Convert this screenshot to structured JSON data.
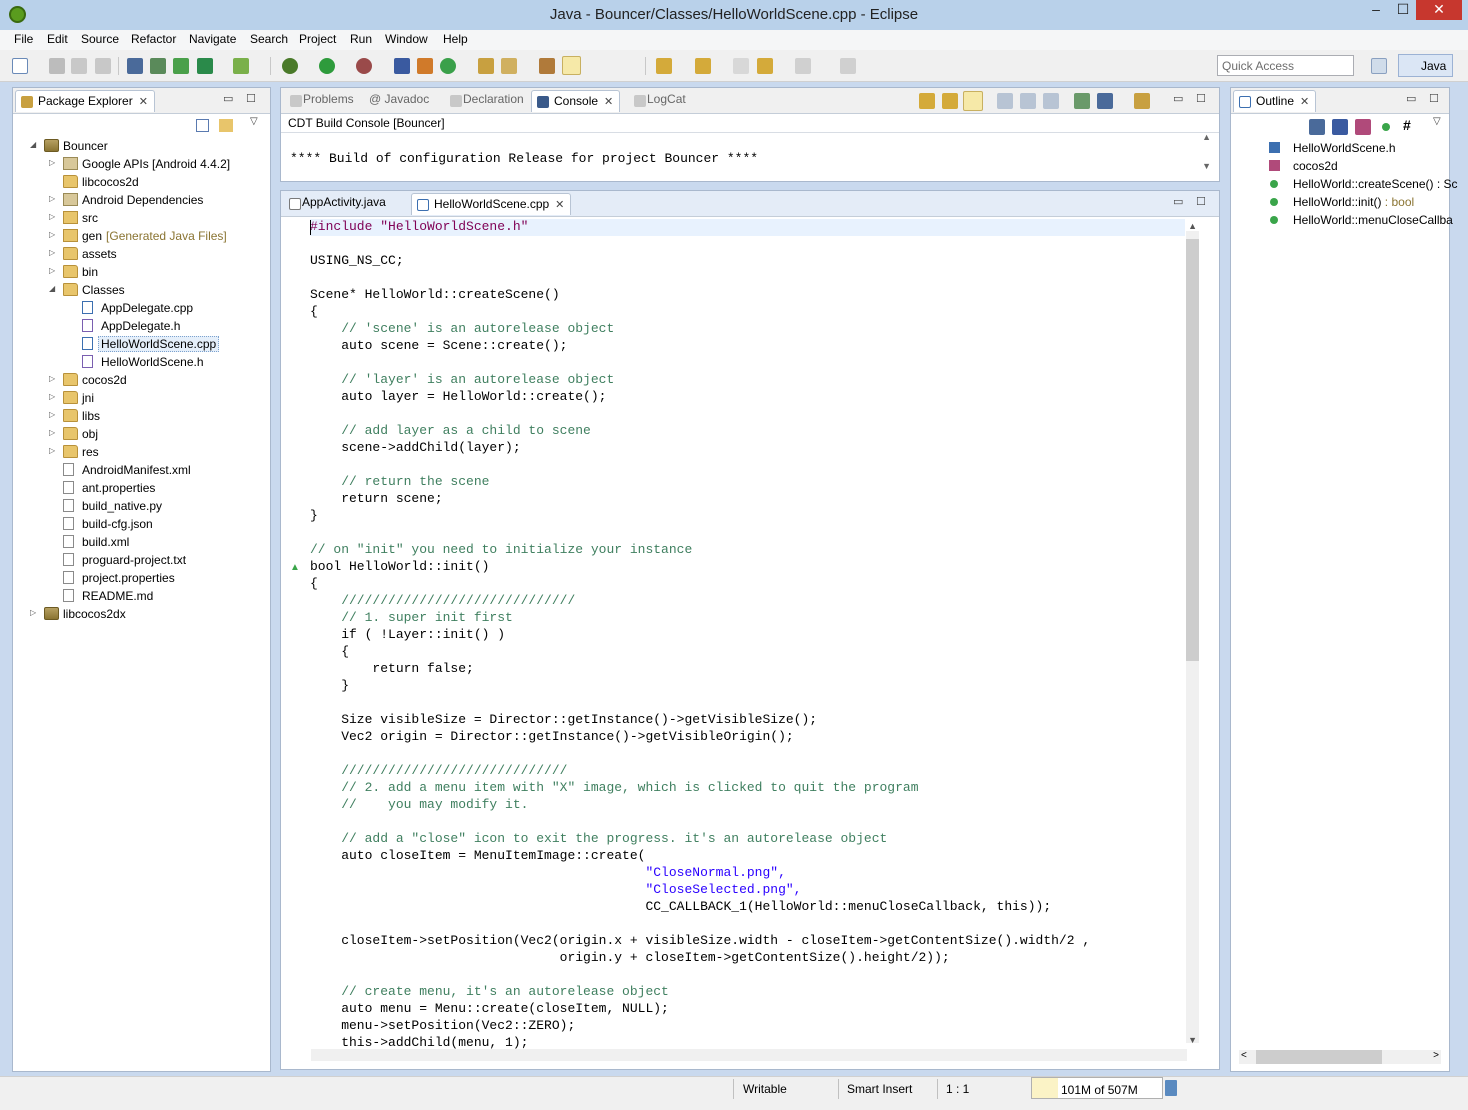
{
  "window": {
    "title": "Java - Bouncer/Classes/HelloWorldScene.cpp - Eclipse",
    "minimize": "–",
    "maximize": "☐",
    "close": "✕"
  },
  "menu": [
    "File",
    "Edit",
    "Source",
    "Refactor",
    "Navigate",
    "Search",
    "Project",
    "Run",
    "Window",
    "Help"
  ],
  "toolbar": {
    "quick_access_placeholder": "Quick Access",
    "perspective": "Java"
  },
  "package_explorer": {
    "tab": "Package Explorer",
    "items": [
      {
        "label": "Bouncer",
        "indent": 0,
        "icon": "project-icon",
        "expanded": true
      },
      {
        "label": "Google APIs [Android 4.4.2]",
        "indent": 1,
        "icon": "library-icon"
      },
      {
        "label": "libcocos2d",
        "indent": 1,
        "icon": "folder-icon",
        "leaf": true
      },
      {
        "label": "Android Dependencies",
        "indent": 1,
        "icon": "library-icon"
      },
      {
        "label": "src",
        "indent": 1,
        "icon": "source-folder-icon"
      },
      {
        "label": "gen",
        "suffix": "[Generated Java Files]",
        "indent": 1,
        "icon": "source-folder-icon"
      },
      {
        "label": "assets",
        "indent": 1,
        "icon": "folder-icon"
      },
      {
        "label": "bin",
        "indent": 1,
        "icon": "folder-icon"
      },
      {
        "label": "Classes",
        "indent": 1,
        "icon": "folder-icon",
        "expanded": true
      },
      {
        "label": "AppDelegate.cpp",
        "indent": 2,
        "icon": "cpp-file-icon",
        "leaf": true
      },
      {
        "label": "AppDelegate.h",
        "indent": 2,
        "icon": "header-file-icon",
        "leaf": true
      },
      {
        "label": "HelloWorldScene.cpp",
        "indent": 2,
        "icon": "cpp-file-icon",
        "leaf": true,
        "selected": true
      },
      {
        "label": "HelloWorldScene.h",
        "indent": 2,
        "icon": "header-file-icon",
        "leaf": true
      },
      {
        "label": "cocos2d",
        "indent": 1,
        "icon": "folder-icon"
      },
      {
        "label": "jni",
        "indent": 1,
        "icon": "folder-icon"
      },
      {
        "label": "libs",
        "indent": 1,
        "icon": "folder-icon"
      },
      {
        "label": "obj",
        "indent": 1,
        "icon": "folder-icon"
      },
      {
        "label": "res",
        "indent": 1,
        "icon": "folder-icon"
      },
      {
        "label": "AndroidManifest.xml",
        "indent": 1,
        "icon": "file-icon",
        "leaf": true
      },
      {
        "label": "ant.properties",
        "indent": 1,
        "icon": "file-icon",
        "leaf": true
      },
      {
        "label": "build_native.py",
        "indent": 1,
        "icon": "file-icon",
        "leaf": true
      },
      {
        "label": "build-cfg.json",
        "indent": 1,
        "icon": "file-icon",
        "leaf": true
      },
      {
        "label": "build.xml",
        "indent": 1,
        "icon": "file-icon",
        "leaf": true
      },
      {
        "label": "proguard-project.txt",
        "indent": 1,
        "icon": "file-icon",
        "leaf": true
      },
      {
        "label": "project.properties",
        "indent": 1,
        "icon": "file-icon",
        "leaf": true
      },
      {
        "label": "README.md",
        "indent": 1,
        "icon": "file-icon",
        "leaf": true
      },
      {
        "label": "libcocos2dx",
        "indent": 0,
        "icon": "project-icon"
      }
    ]
  },
  "console_panel": {
    "tabs": [
      {
        "label": "Problems"
      },
      {
        "label": "@ Javadoc"
      },
      {
        "label": "Declaration"
      },
      {
        "label": "Console",
        "active": true
      },
      {
        "label": "LogCat"
      }
    ],
    "header": "CDT Build Console [Bouncer]",
    "text": "**** Build of configuration Release for project Bouncer ****"
  },
  "editor": {
    "tabs": [
      {
        "label": "AppActivity.java"
      },
      {
        "label": "HelloWorldScene.cpp",
        "active": true
      }
    ],
    "lines": [
      {
        "text": "#include \"HelloWorldScene.h\"",
        "kind": "pp"
      },
      {
        "text": ""
      },
      {
        "text": "USING_NS_CC;"
      },
      {
        "text": ""
      },
      {
        "text": "Scene* HelloWorld::createScene()"
      },
      {
        "text": "{"
      },
      {
        "text": "    // 'scene' is an autorelease object",
        "kind": "cm"
      },
      {
        "text": "    auto scene = Scene::create();"
      },
      {
        "text": ""
      },
      {
        "text": "    // 'layer' is an autorelease object",
        "kind": "cm"
      },
      {
        "text": "    auto layer = HelloWorld::create();"
      },
      {
        "text": ""
      },
      {
        "text": "    // add layer as a child to scene",
        "kind": "cm"
      },
      {
        "text": "    scene->addChild(layer);"
      },
      {
        "text": ""
      },
      {
        "text": "    // return the scene",
        "kind": "cm"
      },
      {
        "text": "    return scene;"
      },
      {
        "text": "}"
      },
      {
        "text": ""
      },
      {
        "text": "// on \"init\" you need to initialize your instance",
        "kind": "cm"
      },
      {
        "text": "bool HelloWorld::init()"
      },
      {
        "text": "{"
      },
      {
        "text": "    //////////////////////////////",
        "kind": "cm"
      },
      {
        "text": "    // 1. super init first",
        "kind": "cm"
      },
      {
        "text": "    if ( !Layer::init() )"
      },
      {
        "text": "    {"
      },
      {
        "text": "        return false;"
      },
      {
        "text": "    }"
      },
      {
        "text": ""
      },
      {
        "text": "    Size visibleSize = Director::getInstance()->getVisibleSize();"
      },
      {
        "text": "    Vec2 origin = Director::getInstance()->getVisibleOrigin();"
      },
      {
        "text": ""
      },
      {
        "text": "    /////////////////////////////",
        "kind": "cm"
      },
      {
        "text": "    // 2. add a menu item with \"X\" image, which is clicked to quit the program",
        "kind": "cm"
      },
      {
        "text": "    //    you may modify it.",
        "kind": "cm"
      },
      {
        "text": ""
      },
      {
        "text": "    // add a \"close\" icon to exit the progress. it's an autorelease object",
        "kind": "cm"
      },
      {
        "text": "    auto closeItem = MenuItemImage::create("
      },
      {
        "text": "                                           \"CloseNormal.png\",",
        "kind": "str"
      },
      {
        "text": "                                           \"CloseSelected.png\",",
        "kind": "str"
      },
      {
        "text": "                                           CC_CALLBACK_1(HelloWorld::menuCloseCallback, this));"
      },
      {
        "text": ""
      },
      {
        "text": "    closeItem->setPosition(Vec2(origin.x + visibleSize.width - closeItem->getContentSize().width/2 ,"
      },
      {
        "text": "                                origin.y + closeItem->getContentSize().height/2));"
      },
      {
        "text": ""
      },
      {
        "text": "    // create menu, it's an autorelease object",
        "kind": "cm"
      },
      {
        "text": "    auto menu = Menu::create(closeItem, NULL);"
      },
      {
        "text": "    menu->setPosition(Vec2::ZERO);"
      },
      {
        "text": "    this->addChild(menu, 1);"
      }
    ]
  },
  "outline": {
    "tab": "Outline",
    "items": [
      {
        "label": "HelloWorldScene.h",
        "icon": "include-icon",
        "color": "#3c6fb0"
      },
      {
        "label": "cocos2d",
        "icon": "namespace-icon",
        "color": "#b04a7a"
      },
      {
        "label": "HelloWorld::createScene() : Sc",
        "icon": "method-icon",
        "color": "#3aa54a"
      },
      {
        "label": "HelloWorld::init()",
        "suffix": " : bool",
        "icon": "method-icon",
        "color": "#3aa54a"
      },
      {
        "label": "HelloWorld::menuCloseCallba",
        "icon": "method-icon",
        "color": "#3aa54a"
      }
    ]
  },
  "status": {
    "writable": "Writable",
    "insert_mode": "Smart Insert",
    "position": "1 : 1",
    "heap": "101M of 507M",
    "heap_used_fraction": 0.2
  },
  "colors": {
    "accent": "#3c6fb0",
    "comment": "#3f7f5f",
    "keyword": "#7f0055",
    "string": "#2a00ff"
  }
}
